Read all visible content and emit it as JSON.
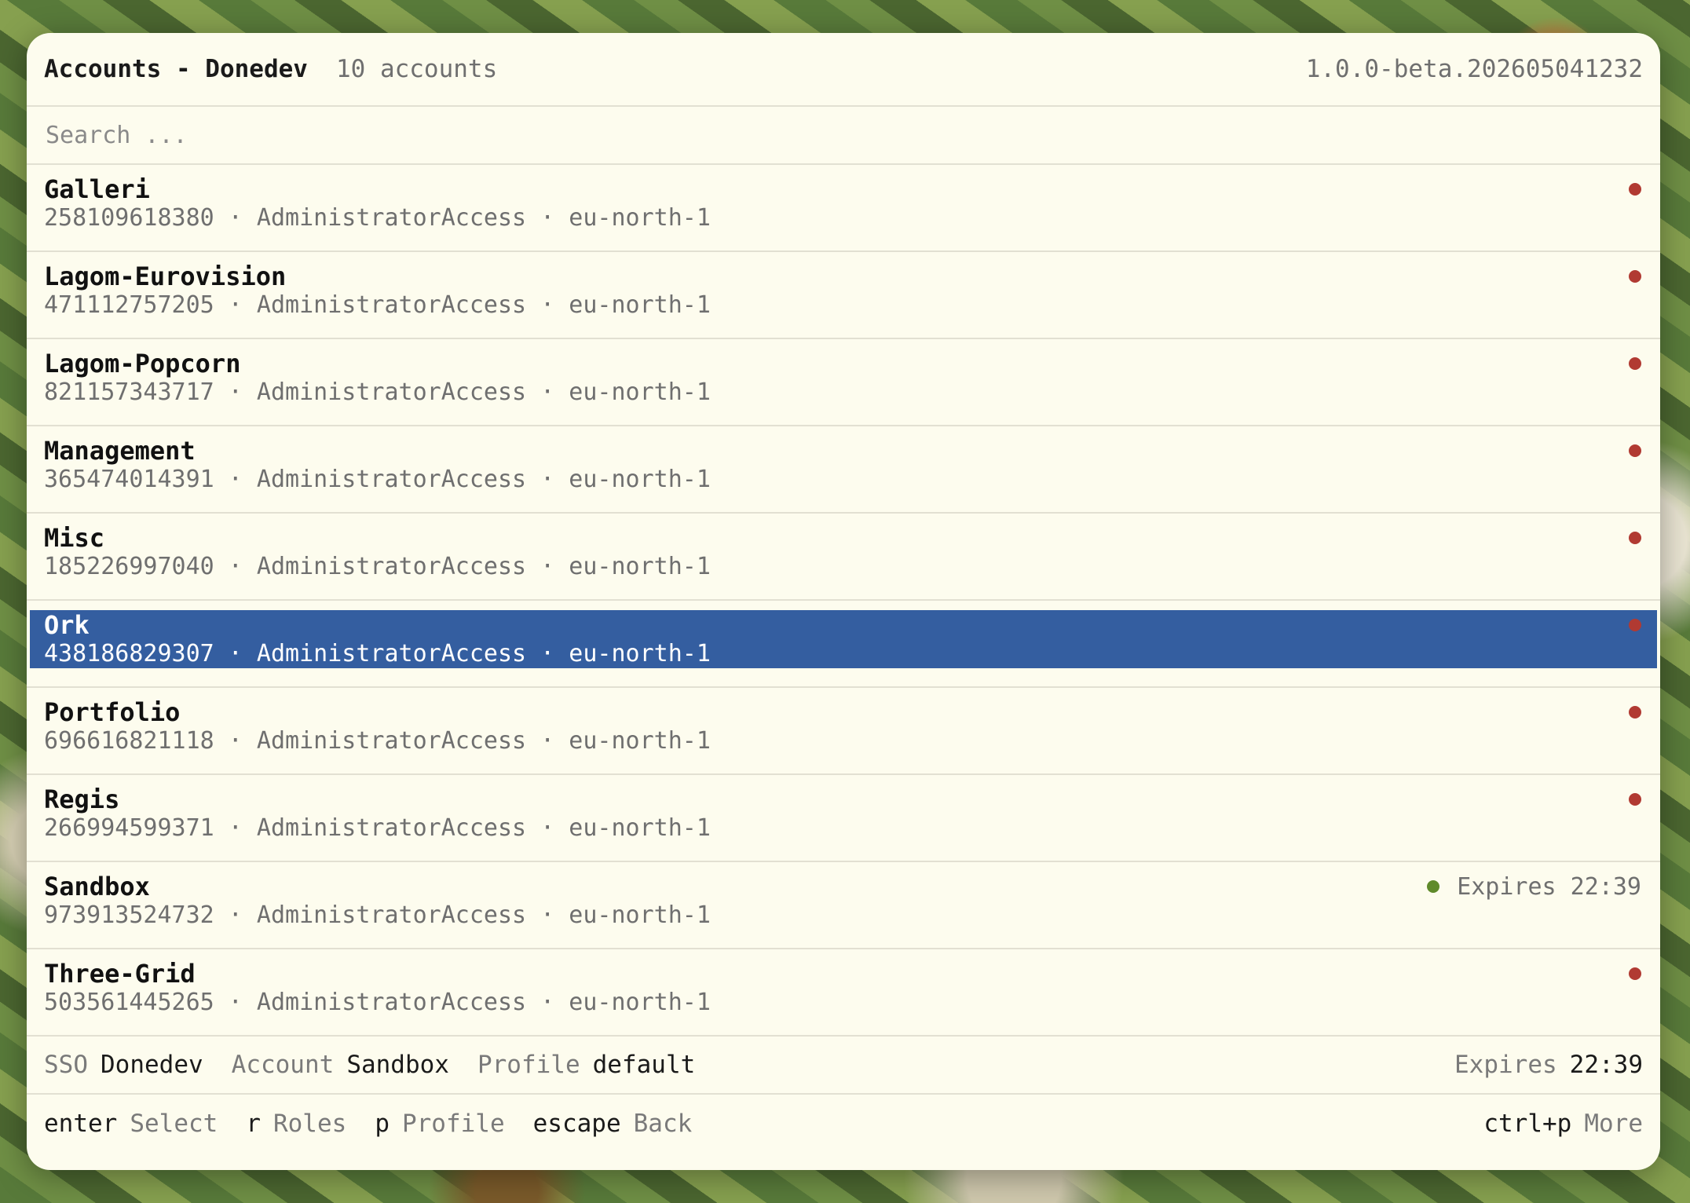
{
  "header": {
    "title": "Accounts - Donedev",
    "count": "10 accounts",
    "version": "1.0.0-beta.202605041232"
  },
  "search": {
    "placeholder": "Search ..."
  },
  "accounts": [
    {
      "name": "Galleri",
      "meta": "258109618380 · AdministratorAccess · eu-north-1",
      "status": "inactive",
      "status_text": ""
    },
    {
      "name": "Lagom-Eurovision",
      "meta": "471112757205 · AdministratorAccess · eu-north-1",
      "status": "inactive",
      "status_text": ""
    },
    {
      "name": "Lagom-Popcorn",
      "meta": "821157343717 · AdministratorAccess · eu-north-1",
      "status": "inactive",
      "status_text": ""
    },
    {
      "name": "Management",
      "meta": "365474014391 · AdministratorAccess · eu-north-1",
      "status": "inactive",
      "status_text": ""
    },
    {
      "name": "Misc",
      "meta": "185226997040 · AdministratorAccess · eu-north-1",
      "status": "inactive",
      "status_text": ""
    },
    {
      "name": "Ork",
      "meta": "438186829307 · AdministratorAccess · eu-north-1",
      "status": "inactive",
      "status_text": "",
      "selected": true
    },
    {
      "name": "Portfolio",
      "meta": "696616821118 · AdministratorAccess · eu-north-1",
      "status": "inactive",
      "status_text": ""
    },
    {
      "name": "Regis",
      "meta": "266994599371 · AdministratorAccess · eu-north-1",
      "status": "inactive",
      "status_text": ""
    },
    {
      "name": "Sandbox",
      "meta": "973913524732 · AdministratorAccess · eu-north-1",
      "status": "active",
      "status_text": "Expires 22:39"
    },
    {
      "name": "Three-Grid",
      "meta": "503561445265 · AdministratorAccess · eu-north-1",
      "status": "inactive",
      "status_text": ""
    }
  ],
  "statusbar": {
    "sso_label": "SSO",
    "sso_value": "Donedev",
    "account_label": "Account",
    "account_value": "Sandbox",
    "profile_label": "Profile",
    "profile_value": "default",
    "expires_label": "Expires",
    "expires_value": "22:39"
  },
  "footer": {
    "shortcuts": [
      {
        "key": "enter",
        "action": "Select"
      },
      {
        "key": "r",
        "action": "Roles"
      },
      {
        "key": "p",
        "action": "Profile"
      },
      {
        "key": "escape",
        "action": "Back"
      }
    ],
    "more_key": "ctrl+p",
    "more_action": "More"
  },
  "colors": {
    "inactive_dot": "#b13a32",
    "active_dot": "#5f8a2a",
    "selection": "#345ea0"
  }
}
